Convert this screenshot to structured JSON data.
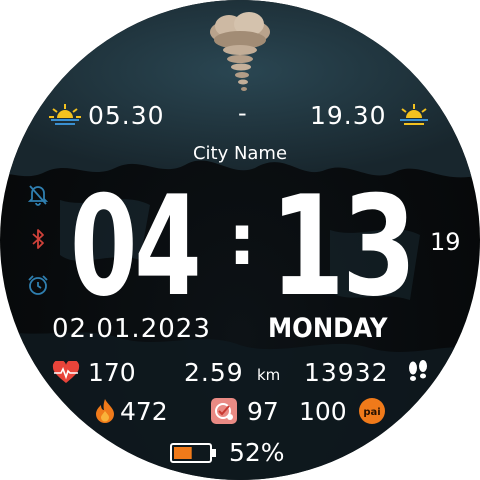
{
  "sun": {
    "sunrise": "05.30",
    "separator": "-",
    "sunset": "19.30"
  },
  "weather": {
    "icon": "tornado-icon"
  },
  "city": "City Name",
  "time": {
    "hours": "04",
    "colon": ":",
    "minutes": "13",
    "seconds": "19"
  },
  "date": {
    "date": "02.01.2023",
    "weekday": "MONDAY"
  },
  "stats": {
    "heart_rate": "170",
    "distance": "2.59",
    "distance_unit": "km",
    "steps": "13932",
    "calories": "472",
    "stress": "97",
    "pai": "100",
    "pai_label": "pai"
  },
  "battery": {
    "percent_text": "52%",
    "level": 0.52
  },
  "status_icons": [
    "alarm-off-icon",
    "bluetooth-icon",
    "alarm-icon"
  ],
  "colors": {
    "accent_orange": "#f07a1a",
    "heart_red": "#e8443a",
    "status_blue": "#2f7fb0",
    "status_red": "#d0413a",
    "sun_yellow": "#f4c21f"
  }
}
